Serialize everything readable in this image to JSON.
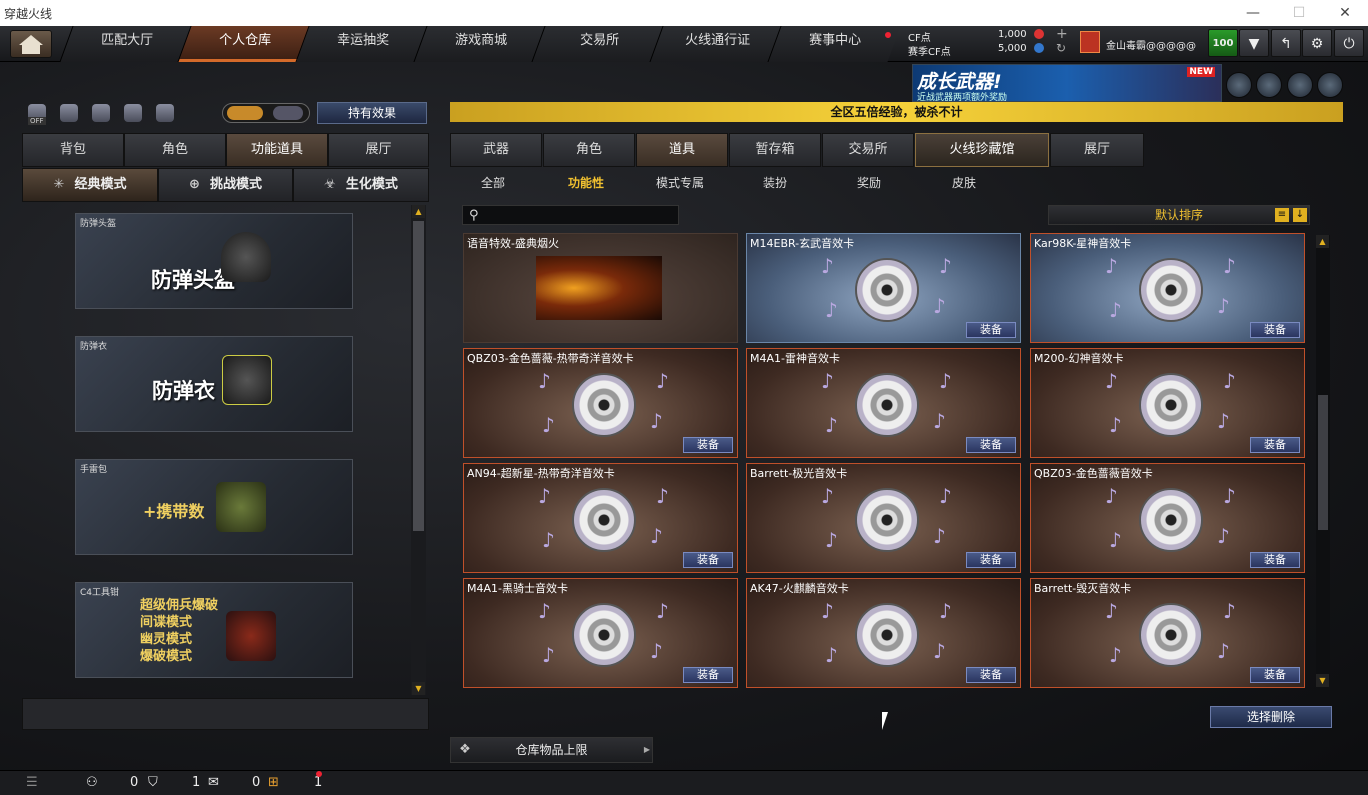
{
  "window": {
    "title": "穿越火线",
    "min": "—",
    "max": "☐",
    "close": "✕"
  },
  "nav": [
    "匹配大厅",
    "个人仓库",
    "幸运抽奖",
    "游戏商城",
    "交易所",
    "火线通行证",
    "赛事中心"
  ],
  "currency": {
    "cf_label": "CF点",
    "cf_value": "1,000",
    "match_label": "赛季CF点",
    "match_value": "5,000",
    "plus": "+",
    "refresh": "↻"
  },
  "user": {
    "name": "金山毒霸@@@@@",
    "level": "100"
  },
  "banner": {
    "title": "成长武器!",
    "subtitle": "近战武器两项额外奖励",
    "badge": "NEW"
  },
  "left": {
    "toggle_off": "OFF",
    "effect_button": "持有效果",
    "tabs": [
      "背包",
      "角色",
      "功能道具",
      "展厅"
    ],
    "modes": [
      "经典模式",
      "挑战模式",
      "生化模式"
    ],
    "cards": [
      {
        "caption": "防弹头盔",
        "text": "防弹头盔"
      },
      {
        "caption": "防弹衣",
        "text": "防弹衣"
      },
      {
        "caption": "手雷包",
        "text": "+携带数"
      },
      {
        "caption": "C4工具钳",
        "lines": [
          "超级佣兵爆破",
          "间谍模式",
          "幽灵模式",
          "爆破模式"
        ]
      }
    ]
  },
  "right": {
    "gold_bar": "全区五倍经验，被杀不计",
    "tabs": [
      "武器",
      "角色",
      "道具",
      "暂存箱",
      "交易所",
      "火线珍藏馆",
      "展厅"
    ],
    "subtabs": [
      "全部",
      "功能性",
      "模式专属",
      "装扮",
      "奖励",
      "皮肤"
    ],
    "search_placeholder": "",
    "sort": "默认排序",
    "equip_label": "装备",
    "cards": [
      {
        "name": "语音特效-盛典烟火"
      },
      {
        "name": "M14EBR-玄武音效卡"
      },
      {
        "name": "Kar98K-星神音效卡"
      },
      {
        "name": "QBZ03-金色蔷薇-热带奇洋音效卡"
      },
      {
        "name": "M4A1-雷神音效卡"
      },
      {
        "name": "M200-幻神音效卡"
      },
      {
        "name": "AN94-超新星-热带奇洋音效卡"
      },
      {
        "name": "Barrett-极光音效卡"
      },
      {
        "name": "QBZ03-金色蔷薇音效卡"
      },
      {
        "name": "M4A1-黑骑士音效卡"
      },
      {
        "name": "AK47-火麒麟音效卡"
      },
      {
        "name": "Barrett-毁灭音效卡"
      }
    ],
    "delete_button": "选择删除",
    "limit_button": "仓库物品上限"
  },
  "status": {
    "c1": "0",
    "c2": "1",
    "c3": "0",
    "c4": "1"
  }
}
